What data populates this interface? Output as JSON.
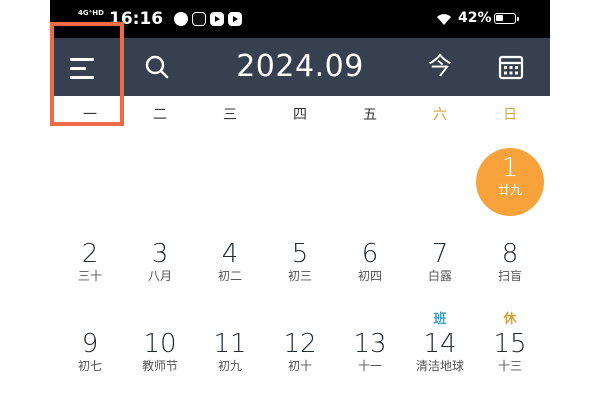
{
  "status_bar": {
    "network": "4G⁺HD",
    "time": "16:16",
    "battery_percent": "42%",
    "battery_level": 0.42,
    "app_icons": [
      "uc-icon",
      "tiktok-icon",
      "video-app-icon",
      "play-app-icon"
    ]
  },
  "header": {
    "title": "2024.09",
    "today_label": "今",
    "background": "#36404f"
  },
  "highlight_color": "#ef6b47",
  "accent_color": "#f7a23b",
  "weekdays": [
    "一",
    "二",
    "三",
    "四",
    "五",
    "六",
    "日"
  ],
  "weeks": [
    [
      {
        "day": "1",
        "lunar": "廿九",
        "selected": true
      }
    ],
    [
      {
        "day": "2",
        "lunar": "三十"
      },
      {
        "day": "3",
        "lunar": "八月"
      },
      {
        "day": "4",
        "lunar": "初二"
      },
      {
        "day": "5",
        "lunar": "初三"
      },
      {
        "day": "6",
        "lunar": "初四"
      },
      {
        "day": "7",
        "lunar": "白露"
      },
      {
        "day": "8",
        "lunar": "扫盲"
      }
    ],
    [
      {
        "day": "9",
        "lunar": "初七"
      },
      {
        "day": "10",
        "lunar": "教师节"
      },
      {
        "day": "11",
        "lunar": "初九"
      },
      {
        "day": "12",
        "lunar": "初十"
      },
      {
        "day": "13",
        "lunar": "十一"
      },
      {
        "day": "14",
        "lunar": "清洁地球",
        "tag": "班",
        "tag_color": "#3aa0c8"
      },
      {
        "day": "15",
        "lunar": "十三",
        "tag": "休",
        "tag_color": "#d8a23a"
      }
    ]
  ]
}
